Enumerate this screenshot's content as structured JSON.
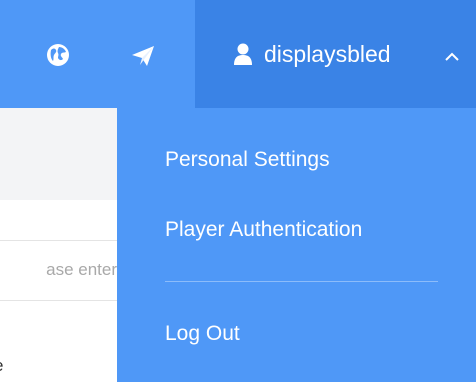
{
  "header": {
    "username": "displaysbled",
    "icons": [
      "globe-icon",
      "send-icon",
      "user-icon",
      "chevron-up-icon"
    ],
    "colors": {
      "bar": "#4f98f7",
      "active": "#3a83e6",
      "text": "#ffffff"
    }
  },
  "background_page": {
    "input_placeholder": "ase enter",
    "bottom_label_fragment": "e"
  },
  "user_menu": {
    "items": [
      {
        "label": "Personal Settings"
      },
      {
        "label": "Player Authentication"
      },
      {
        "label": "Log Out"
      }
    ]
  }
}
